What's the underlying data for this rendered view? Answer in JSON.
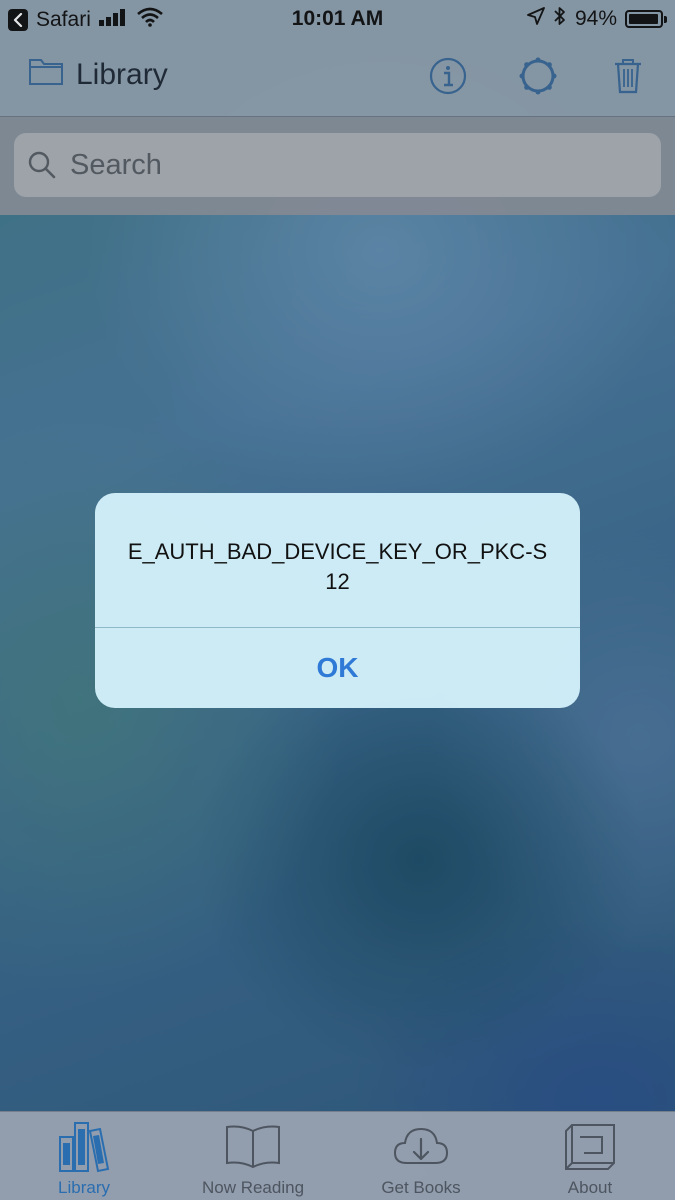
{
  "status_bar": {
    "back_app": "Safari",
    "time": "10:01 AM",
    "battery": "94%"
  },
  "nav": {
    "title": "Library",
    "icons": [
      "folder-icon",
      "info-icon",
      "settings-icon",
      "trash-icon"
    ]
  },
  "search": {
    "placeholder": "Search",
    "value": ""
  },
  "alert": {
    "message": "E_AUTH_BAD_DEVICE_KEY_OR_PKC-S12",
    "button_label": "OK"
  },
  "tabs": [
    {
      "label": "Library",
      "icon": "books-icon",
      "active": true
    },
    {
      "label": "Now Reading",
      "icon": "open-book-icon",
      "active": false
    },
    {
      "label": "Get Books",
      "icon": "cloud-download-icon",
      "active": false
    },
    {
      "label": "About",
      "icon": "about-icon",
      "active": false
    }
  ],
  "colors": {
    "accent": "#2e7ad6",
    "active_tab": "#2a6eb0",
    "nav_icon": "#3a6a9a"
  }
}
